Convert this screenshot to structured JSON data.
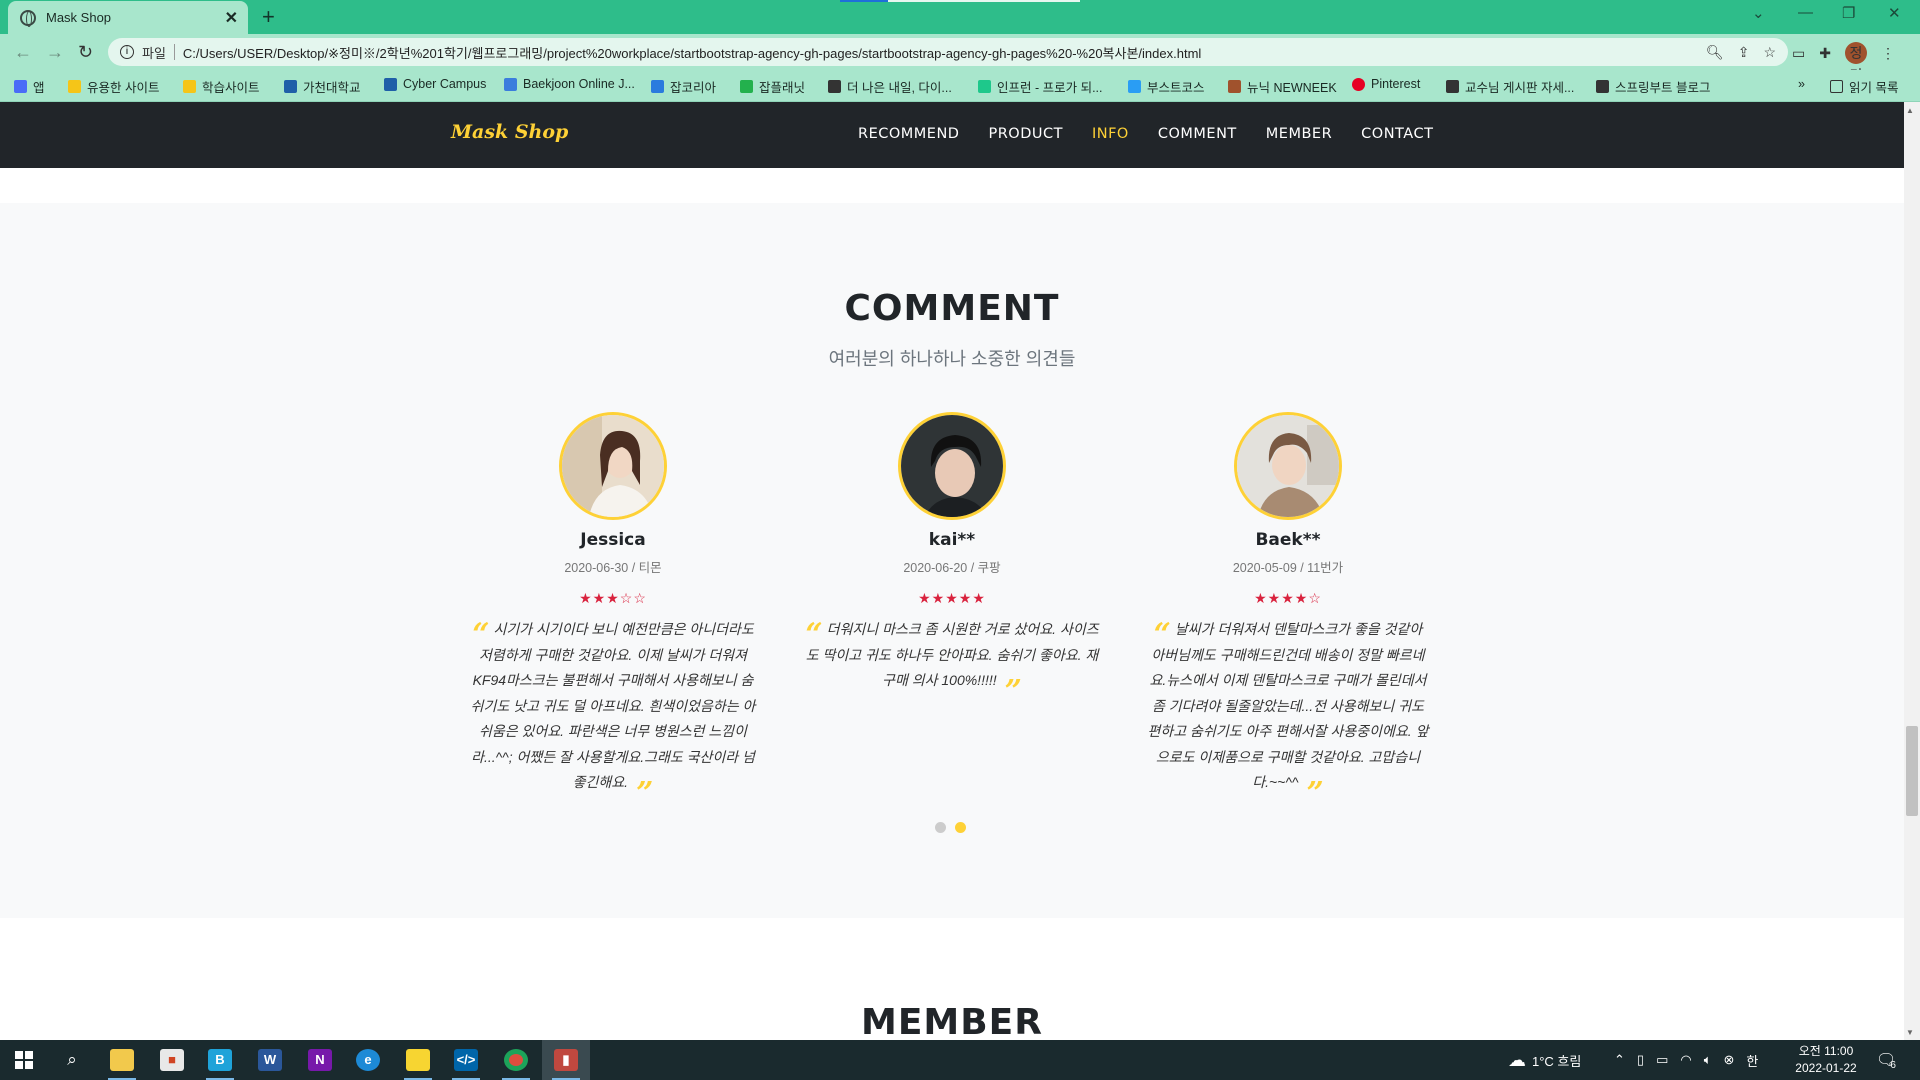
{
  "browser": {
    "tab_title": "Mask Shop",
    "url_scheme": "파일",
    "url": "C:/Users/USER/Desktop/※정미※/2학년%201학기/웹프로그래밍/project%20workplace/startbootstrap-agency-gh-pages/startbootstrap-agency-gh-pages%20-%20복사본/index.html",
    "profile_initial": "정미",
    "bookmarks": [
      {
        "label": "앱",
        "color": "#4a6cf7"
      },
      {
        "label": "유용한 사이트",
        "color": "#f5c518"
      },
      {
        "label": "학습사이트",
        "color": "#f5c518"
      },
      {
        "label": "가천대학교",
        "color": "#1f5fa8"
      },
      {
        "label": "Cyber Campus",
        "color": "#1f5fa8"
      },
      {
        "label": "Baekjoon Online J...",
        "color": "#3b7ddd"
      },
      {
        "label": "잡코리아",
        "color": "#2a7bde"
      },
      {
        "label": "잡플래닛",
        "color": "#23b14d"
      },
      {
        "label": "더 나은 내일, 다이...",
        "color": "#333333"
      },
      {
        "label": "인프런 - 프로가 되...",
        "color": "#1ec88b"
      },
      {
        "label": "부스트코스",
        "color": "#2a9df4"
      },
      {
        "label": "뉴닉 NEWNEEK",
        "color": "#a0522d"
      },
      {
        "label": "Pinterest",
        "color": "#e60023"
      },
      {
        "label": "교수님 게시판 자세...",
        "color": "#333333"
      },
      {
        "label": "스프링부트 블로그",
        "color": "#333333"
      }
    ],
    "reading_list": "읽기 목록"
  },
  "site": {
    "brand": "Mask Shop",
    "nav": [
      {
        "label": "RECOMMEND",
        "active": false
      },
      {
        "label": "PRODUCT",
        "active": false
      },
      {
        "label": "INFO",
        "active": true
      },
      {
        "label": "COMMENT",
        "active": false
      },
      {
        "label": "MEMBER",
        "active": false
      },
      {
        "label": "CONTACT",
        "active": false
      }
    ],
    "accent_color": "#fed136",
    "comment_section": {
      "title": "COMMENT",
      "subtitle": "여러분의 하나하나 소중한 의견들",
      "reviews": [
        {
          "name": "Jessica",
          "meta": "2020-06-30 / 티몬",
          "stars": "★★★☆☆",
          "rating": 3.5,
          "text": "시기가 시기이다 보니 예전만큼은 아니더라도 저렴하게 구매한 것같아요. 이제 날씨가 더워져 KF94마스크는 불편해서 구매해서 사용해보니 숨쉬기도 낫고 귀도 덜 아프네요. 흰색이었음하는 아쉬움은 있어요. 파란색은 너무 병원스런 느낌이라...^^; 어쨌든 잘 사용할게요.그래도 국산이라 넘 좋긴해요."
        },
        {
          "name": "kai**",
          "meta": "2020-06-20 / 쿠팡",
          "stars": "★★★★★",
          "rating": 5,
          "text": "더워지니 마스크 좀 시원한 거로 샀어요. 사이즈도 딱이고 귀도 하나두 안아파요. 숨쉬기 좋아요. 재구매 의사 100%!!!!!"
        },
        {
          "name": "Baek**",
          "meta": "2020-05-09 / 11번가",
          "stars": "★★★★☆",
          "rating": 4,
          "text": "날씨가 더워져서 덴탈마스크가 좋을 것같아 아버님께도 구매해드린건데 배송이 정말 빠르네요.뉴스에서 이제 덴탈마스크로 구매가 몰린데서 좀 기다려야 될줄알았는데...전 사용해보니 귀도 편하고 숨쉬기도 아주 편해서잘 사용중이에요. 앞으로도 이제품으로 구매할 것같아요. 고맙습니다.~~^^"
        }
      ],
      "carousel_active_index": 1
    },
    "member_section": {
      "title": "MEMBER"
    }
  },
  "taskbar": {
    "weather": "1°C  흐림",
    "ime": "한",
    "time": "오전 11:00",
    "date": "2022-01-22",
    "notifications": "6"
  }
}
